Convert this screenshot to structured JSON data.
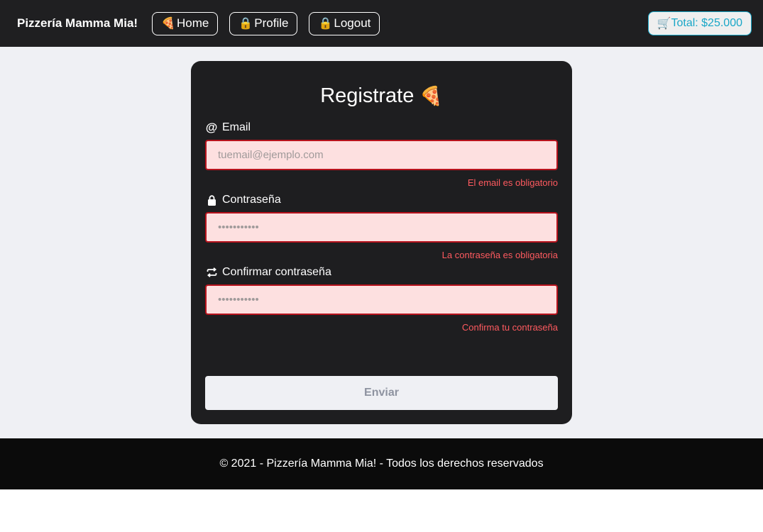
{
  "navbar": {
    "brand": "Pizzería Mamma Mia!",
    "links": [
      {
        "icon": "🍕",
        "label": "Home"
      },
      {
        "icon": "🔒",
        "label": "Profile"
      },
      {
        "icon": "🔒",
        "label": "Logout"
      }
    ],
    "cart": {
      "icon": "🛒",
      "label": "Total: $25.000"
    }
  },
  "form": {
    "title": "Registrate",
    "title_icon": "🍕",
    "fields": [
      {
        "icon_name": "at-icon",
        "icon": "@",
        "label": "Email",
        "placeholder": "tuemail@ejemplo.com",
        "error": "El email es obligatorio"
      },
      {
        "icon_name": "lock-icon",
        "icon": "lock",
        "label": "Contraseña",
        "placeholder": "•••••••••••",
        "error": "La contraseña es obligatoria"
      },
      {
        "icon_name": "repeat-icon",
        "icon": "⇄",
        "label": "Confirmar contraseña",
        "placeholder": "•••••••••••",
        "error": "Confirma tu contraseña"
      }
    ],
    "submit_label": "Enviar"
  },
  "footer": {
    "text": "© 2021 - Pizzería Mamma Mia! - Todos los derechos reservados"
  },
  "colors": {
    "navbar_bg": "#1f1f21",
    "cart_accent": "#1aa7c7",
    "error": "#ff5a5f",
    "field_bg": "#fde0e0",
    "field_border": "#b7131d"
  }
}
